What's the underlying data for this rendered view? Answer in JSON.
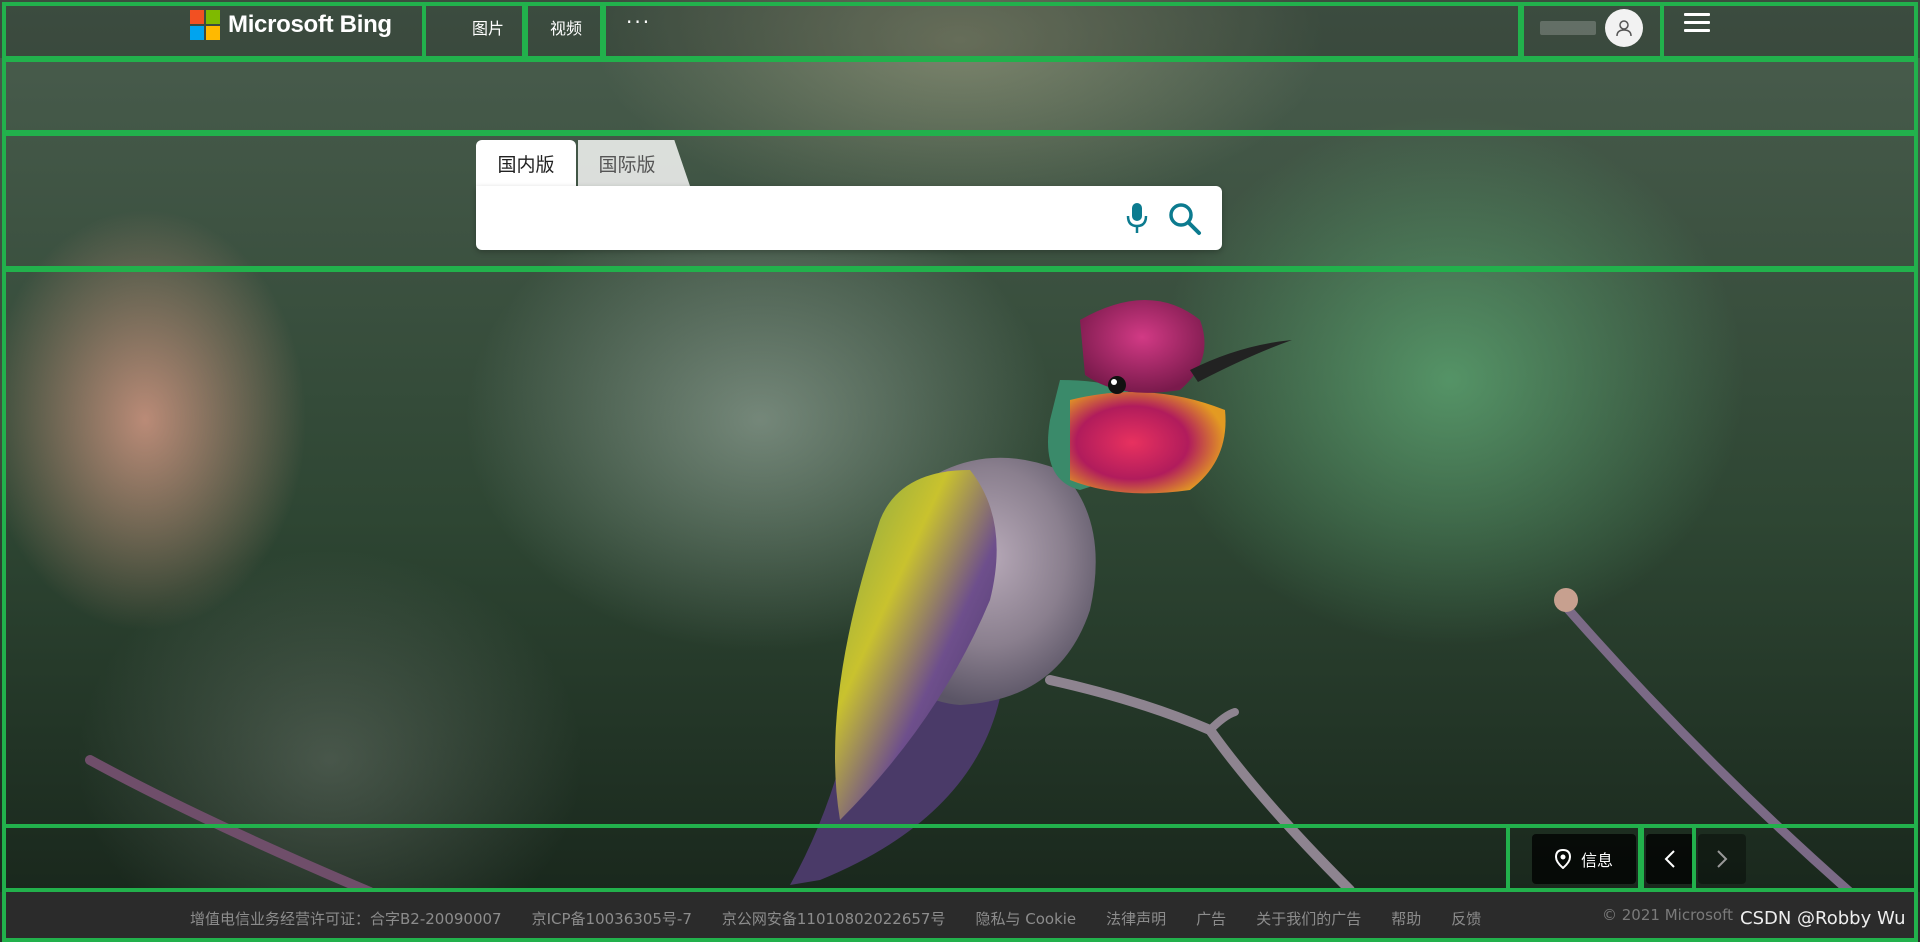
{
  "header": {
    "logo_text": "Microsoft Bing",
    "nav": [
      {
        "label": "图片"
      },
      {
        "label": "视频"
      }
    ],
    "more_label": "···",
    "menu_icon": "hamburger-icon",
    "avatar_icon": "user-icon"
  },
  "search": {
    "tabs": [
      {
        "label": "国内版",
        "active": true
      },
      {
        "label": "国际版",
        "active": false
      }
    ],
    "query": "",
    "placeholder": "",
    "mic_icon": "microphone-icon",
    "search_icon": "search-icon"
  },
  "image_controls": {
    "info_label": "信息",
    "location_icon": "location-pin-icon",
    "prev_icon": "chevron-left-icon",
    "next_icon": "chevron-right-icon"
  },
  "footer": {
    "links": [
      {
        "label": "增值电信业务经营许可证：合字B2-20090007"
      },
      {
        "label": "京ICP备10036305号-7"
      },
      {
        "label": "京公网安备11010802022657号"
      },
      {
        "label": "隐私与 Cookie"
      },
      {
        "label": "法律声明"
      },
      {
        "label": "广告"
      },
      {
        "label": "关于我们的广告"
      },
      {
        "label": "帮助"
      },
      {
        "label": "反馈"
      }
    ],
    "copyright": "© 2021 Microsoft",
    "watermark": "CSDN @Robby Wu"
  },
  "colors": {
    "annotation_box": "#22b14c",
    "accent": "#0c7b8f",
    "ms_red": "#f25022",
    "ms_green": "#7fba00",
    "ms_blue": "#00a4ef",
    "ms_yellow": "#ffb900"
  }
}
